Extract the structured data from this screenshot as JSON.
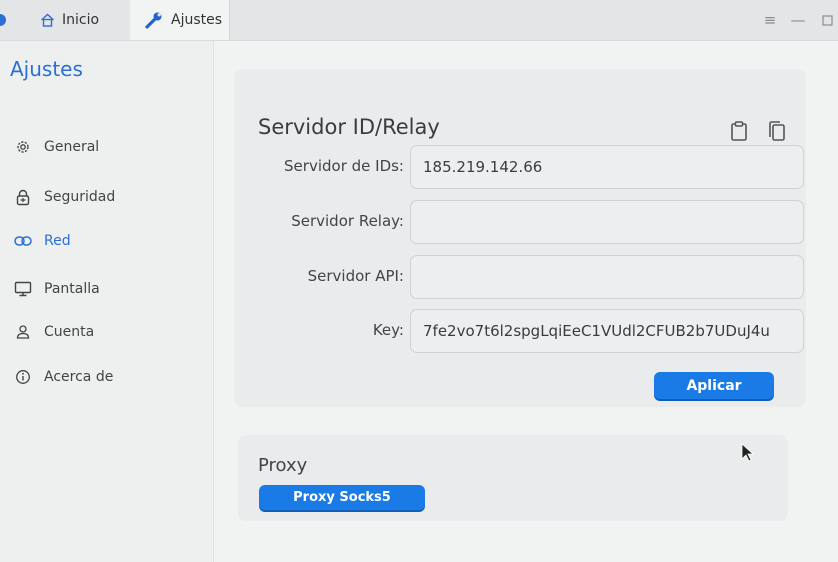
{
  "tabs": [
    {
      "label": "Inicio",
      "icon": "home-icon"
    },
    {
      "label": "Ajustes",
      "icon": "wrench-icon"
    }
  ],
  "window_controls": [
    "menu-icon",
    "minimize-icon",
    "maximize-icon"
  ],
  "sidebar": {
    "title": "Ajustes",
    "items": [
      {
        "label": "General",
        "icon": "gear-icon",
        "active": false
      },
      {
        "label": "Seguridad",
        "icon": "lock-icon",
        "active": false
      },
      {
        "label": "Red",
        "icon": "link-icon",
        "active": true
      },
      {
        "label": "Pantalla",
        "icon": "monitor-icon",
        "active": false
      },
      {
        "label": "Cuenta",
        "icon": "user-icon",
        "active": false
      },
      {
        "label": "Acerca de",
        "icon": "info-icon",
        "active": false
      }
    ]
  },
  "server_card": {
    "title": "Servidor ID/Relay",
    "actions": [
      "clipboard-icon",
      "copy-icon"
    ],
    "fields": {
      "id_server": {
        "label": "Servidor de IDs:",
        "value": "185.219.142.66"
      },
      "relay_server": {
        "label": "Servidor Relay:",
        "value": ""
      },
      "api_server": {
        "label": "Servidor API:",
        "value": ""
      },
      "key": {
        "label": "Key:",
        "value": "7fe2vo7t6l2spgLqiEeC1VUdl2CFUB2b7UDuJ4u"
      }
    },
    "apply_label": "Aplicar"
  },
  "proxy_card": {
    "title": "Proxy",
    "button_label": "Proxy Socks5"
  },
  "colors": {
    "accent": "#2a6fd6",
    "button": "#1a7ae6"
  }
}
